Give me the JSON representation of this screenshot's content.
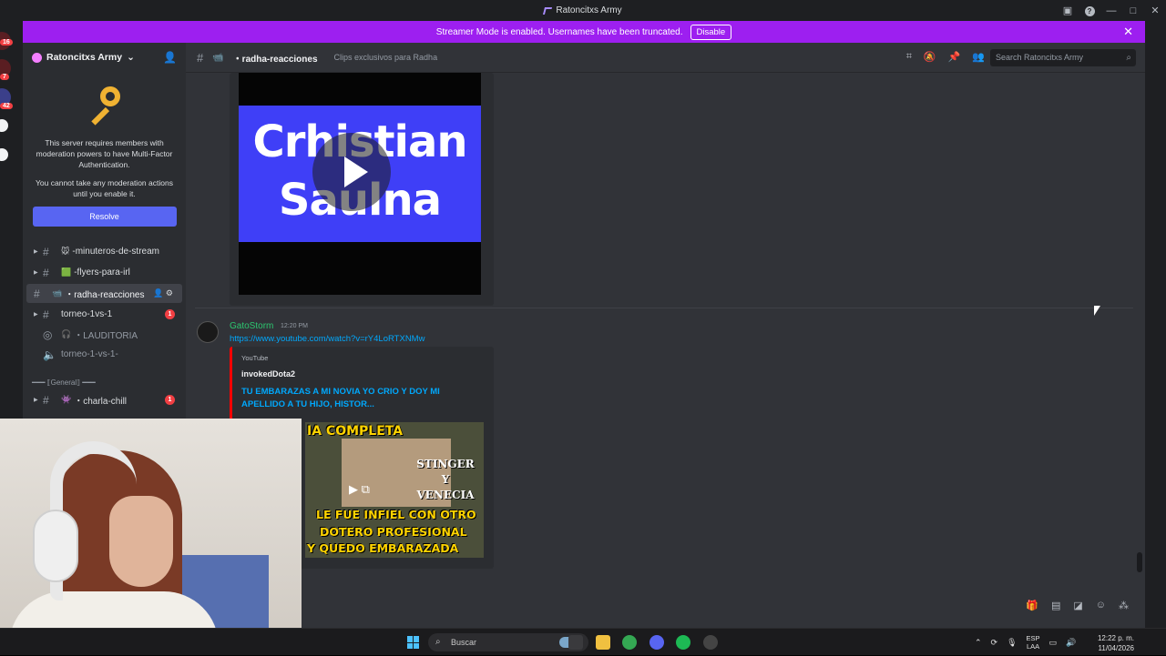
{
  "window": {
    "title": "Ratoncitxs Army"
  },
  "banner": {
    "text": "Streamer Mode is enabled. Usernames have been truncated.",
    "disable_label": "Disable"
  },
  "rail": {
    "badges": [
      "16",
      "7",
      "42"
    ]
  },
  "server": {
    "name": "Ratoncitxs Army"
  },
  "mfa": {
    "line1": "This server requires members with moderation powers to have Multi-Factor Authentication.",
    "line2": "You cannot take any moderation actions until you enable it.",
    "resolve_label": "Resolve"
  },
  "channels": [
    {
      "name": "-minuteros-de-stream",
      "emoji": "🐭",
      "badge": ""
    },
    {
      "name": "-flyers-para-irl",
      "emoji": "🟩",
      "badge": ""
    },
    {
      "name": "・radha-reacciones",
      "emoji": "📹",
      "badge": ""
    },
    {
      "name": "torneo-1vs-1",
      "emoji": "",
      "badge": "1"
    },
    {
      "name": "・LAUDITORIA",
      "emoji": "",
      "badge": ""
    },
    {
      "name": "torneo-1-vs-1-",
      "emoji": "",
      "badge": ""
    },
    {
      "name": "・charla-chill",
      "emoji": "👾",
      "badge": "1"
    }
  ],
  "category": "━━━ ⟦General⟧ ━━━",
  "header": {
    "channel": "・radha-reacciones",
    "topic": "Clips exclusivos para Radha",
    "search_placeholder": "Search Ratoncitxs Army"
  },
  "embed1": {
    "thumb_line1": "Crhistian",
    "thumb_line2": "Saulna"
  },
  "message": {
    "author": "GatoStorm",
    "time": "12:20 PM",
    "link": "https://www.youtube.com/watch?v=rY4LoRTXNMw",
    "provider": "YouTube",
    "channel": "invokedDota2",
    "title": "TU EMBARAZAS A MI NOVIA YO CRIO Y DOY MI APELLIDO A TU HIJO, HISTOR..."
  },
  "thumb2": {
    "top": "IA COMPLETA",
    "names": "STINGER Y VENECIA",
    "bottom1": "LE FUE INFIEL CON OTRO",
    "bottom2": "DOTERO PROFESIONAL",
    "bottom3": "Y QUEDO EMBARAZADA"
  },
  "taskbar": {
    "search_label": "Buscar",
    "lang_line1": "ESP",
    "lang_line2": "LAA",
    "time": "12:22 p. m.",
    "date": "11/04/2026"
  },
  "colors": {
    "banner": "#9d1ff0",
    "accent": "#5865f2",
    "link": "#00a8fc",
    "author": "#2dc770",
    "mention_badge": "#f23f43"
  }
}
